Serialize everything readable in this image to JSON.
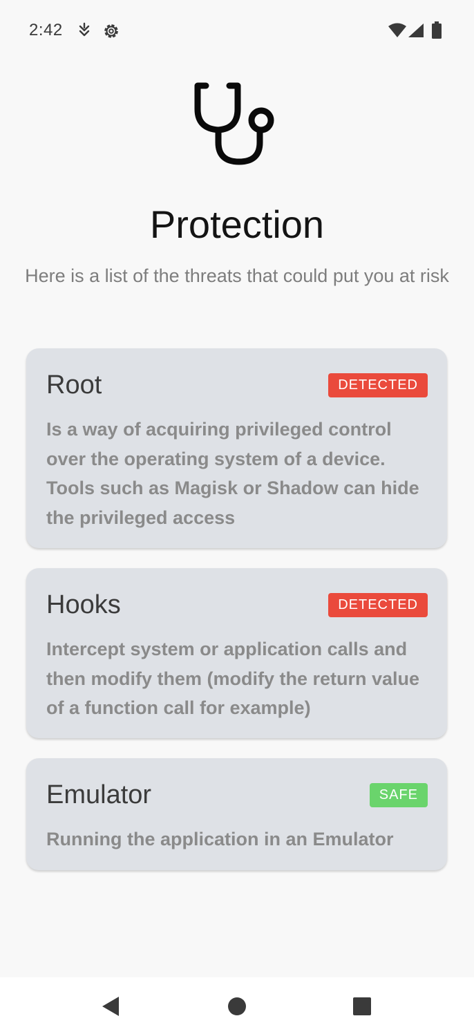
{
  "status_bar": {
    "time": "2:42",
    "icons": [
      "data-saver-icon",
      "settings-icon",
      "wifi-icon",
      "signal-icon",
      "battery-icon"
    ]
  },
  "header": {
    "icon": "stethoscope-icon",
    "title": "Protection",
    "subtitle": "Here is a list of the threats that could put you at risk"
  },
  "threats": [
    {
      "title": "Root",
      "status": "DETECTED",
      "status_color": "#ea4a3c",
      "description": "Is a way of acquiring privileged control over the operating system of a device. Tools such as Magisk or Shadow can hide the privileged access"
    },
    {
      "title": "Hooks",
      "status": "DETECTED",
      "status_color": "#ea4a3c",
      "description": "Intercept system or application calls and then modify them (modify the return value of a function call for example)"
    },
    {
      "title": "Emulator",
      "status": "SAFE",
      "status_color": "#6ad46c",
      "description": "Running the application in an Emulator"
    }
  ],
  "nav_bar": {
    "buttons": [
      "back-icon",
      "home-icon",
      "recents-icon"
    ]
  },
  "colors": {
    "background": "#f8f8f8",
    "card": "#dee1e6",
    "detected": "#ea4a3c",
    "safe": "#6ad46c"
  }
}
